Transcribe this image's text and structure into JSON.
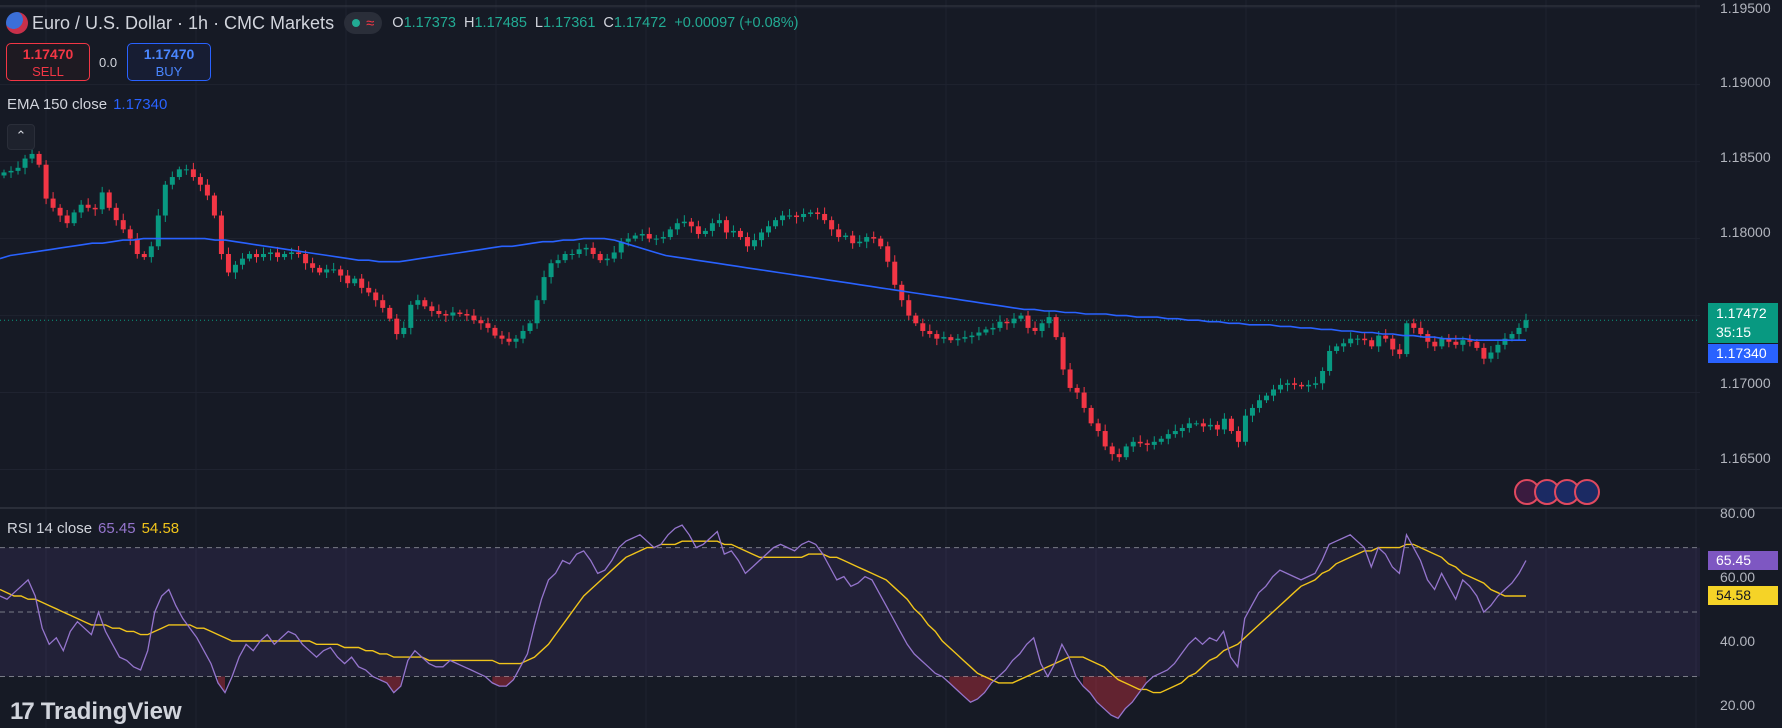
{
  "header": {
    "title": "Euro / U.S. Dollar · 1h · CMC Markets",
    "ohlc": [
      {
        "k": "O",
        "v": "1.17373"
      },
      {
        "k": "H",
        "v": "1.17485"
      },
      {
        "k": "L",
        "v": "1.17361"
      },
      {
        "k": "C",
        "v": "1.17472"
      }
    ],
    "change": "+0.00097 (+0.08%)"
  },
  "trade": {
    "sell_price": "1.17470",
    "sell_label": "SELL",
    "spread": "0.0",
    "buy_price": "1.17470",
    "buy_label": "BUY"
  },
  "ema": {
    "label": "EMA 150 close",
    "value": "1.17340"
  },
  "rsi": {
    "label": "RSI 14 close",
    "value": "65.45",
    "ma_value": "54.58"
  },
  "price_axis": {
    "ticks": [
      "1.19500",
      "1.19000",
      "1.18500",
      "1.18000",
      "1.17000",
      "1.16500"
    ],
    "last_price": "1.17472",
    "countdown": "35:15",
    "ema_tag": "1.17340"
  },
  "rsi_axis": {
    "ticks": [
      "80.00",
      "60.00",
      "40.00",
      "20.00"
    ]
  },
  "branding": {
    "logo_text": "TradingView"
  },
  "colors": {
    "background": "#161a25",
    "up": "#089981",
    "down": "#f23645",
    "ema": "#2962ff",
    "rsi": "#9575cd",
    "rsi_ma": "#f0c41b"
  },
  "chart_data": [
    {
      "type": "candlestick",
      "title": "Euro / U.S. Dollar · 1h · CMC Markets",
      "ylim": [
        1.1625,
        1.1955
      ],
      "series": [
        {
          "name": "EMA 150 close",
          "values": [
            1.1787,
            1.1789,
            1.179,
            1.1791,
            1.1792,
            1.1793,
            1.1794,
            1.1795,
            1.1796,
            1.1797,
            1.1797,
            1.1798,
            1.1799,
            1.1799,
            1.18,
            1.18,
            1.18,
            1.18,
            1.18,
            1.18,
            1.18,
            1.1799,
            1.1799,
            1.1798,
            1.1797,
            1.1796,
            1.1795,
            1.1794,
            1.1793,
            1.1792,
            1.1791,
            1.179,
            1.1789,
            1.1788,
            1.1787,
            1.1786,
            1.1786,
            1.1785,
            1.1785,
            1.1785,
            1.1786,
            1.1787,
            1.1788,
            1.1789,
            1.179,
            1.1791,
            1.1792,
            1.1793,
            1.1794,
            1.1795,
            1.1795,
            1.1796,
            1.1797,
            1.1798,
            1.1798,
            1.1799,
            1.1799,
            1.18,
            1.18,
            1.18,
            1.1799,
            1.1797,
            1.1795,
            1.1793,
            1.1791,
            1.1789,
            1.1788,
            1.1787,
            1.1786,
            1.1785,
            1.1784,
            1.1783,
            1.1782,
            1.1781,
            1.178,
            1.1779,
            1.1778,
            1.1777,
            1.1776,
            1.1775,
            1.1774,
            1.1773,
            1.1772,
            1.1771,
            1.177,
            1.1769,
            1.1768,
            1.1767,
            1.1766,
            1.1765,
            1.1764,
            1.1763,
            1.1762,
            1.1761,
            1.176,
            1.1759,
            1.1758,
            1.1757,
            1.1756,
            1.1755,
            1.1754,
            1.1754,
            1.1753,
            1.1753,
            1.1752,
            1.1752,
            1.1751,
            1.1751,
            1.1751,
            1.175,
            1.175,
            1.1749,
            1.1749,
            1.1749,
            1.1748,
            1.1748,
            1.1747,
            1.1747,
            1.1746,
            1.1746,
            1.1745,
            1.1745,
            1.1744,
            1.1744,
            1.1744,
            1.1743,
            1.1743,
            1.1742,
            1.1742,
            1.1741,
            1.1741,
            1.174,
            1.174,
            1.1739,
            1.1739,
            1.1738,
            1.1738,
            1.1737,
            1.1737,
            1.1736,
            1.1736,
            1.1735,
            1.1735,
            1.1735,
            1.1734,
            1.1734,
            1.1734,
            1.1734,
            1.1734,
            1.1734
          ]
        },
        {
          "name": "close",
          "values": [
            1.1843,
            1.1844,
            1.1846,
            1.1852,
            1.1855,
            1.1848,
            1.1826,
            1.182,
            1.1815,
            1.181,
            1.1817,
            1.1822,
            1.182,
            1.1819,
            1.183,
            1.182,
            1.1812,
            1.1806,
            1.18,
            1.179,
            1.1788,
            1.1795,
            1.1815,
            1.1835,
            1.184,
            1.1845,
            1.1845,
            1.184,
            1.1835,
            1.1828,
            1.1815,
            1.179,
            1.1778,
            1.1783,
            1.1787,
            1.179,
            1.1788,
            1.179,
            1.1791,
            1.1788,
            1.179,
            1.1791,
            1.179,
            1.1784,
            1.1781,
            1.1778,
            1.178,
            1.178,
            1.1776,
            1.1771,
            1.1774,
            1.1768,
            1.1765,
            1.176,
            1.1755,
            1.1748,
            1.1738,
            1.1742,
            1.1757,
            1.176,
            1.1756,
            1.1753,
            1.1751,
            1.175,
            1.1752,
            1.1751,
            1.175,
            1.1747,
            1.1745,
            1.1742,
            1.1737,
            1.1735,
            1.1733,
            1.1735,
            1.174,
            1.1745,
            1.176,
            1.1775,
            1.1784,
            1.1786,
            1.179,
            1.179,
            1.1793,
            1.1794,
            1.179,
            1.1786,
            1.1787,
            1.1791,
            1.1798,
            1.18,
            1.1802,
            1.1803,
            1.18,
            1.18,
            1.1801,
            1.1806,
            1.181,
            1.1811,
            1.1808,
            1.1803,
            1.1805,
            1.181,
            1.1812,
            1.1804,
            1.1805,
            1.1801,
            1.1795,
            1.1799,
            1.1804,
            1.1808,
            1.1812,
            1.1815,
            1.1815,
            1.1814,
            1.1816,
            1.1817,
            1.1816,
            1.1812,
            1.1806,
            1.1801,
            1.1802,
            1.1797,
            1.1798,
            1.1801,
            1.18,
            1.1795,
            1.1785,
            1.177,
            1.176,
            1.175,
            1.1745,
            1.174,
            1.1738,
            1.1735,
            1.1736,
            1.1734,
            1.1735,
            1.1736,
            1.1737,
            1.1739,
            1.1741,
            1.1742,
            1.1746,
            1.1745,
            1.1748,
            1.175,
            1.1742,
            1.174,
            1.1745,
            1.1749,
            1.1736,
            1.1715,
            1.1703,
            1.17,
            1.169,
            1.168,
            1.1675,
            1.1665,
            1.166,
            1.1658,
            1.1665,
            1.1668,
            1.1667,
            1.1666,
            1.1668,
            1.167,
            1.1673,
            1.1675,
            1.1677,
            1.168,
            1.168,
            1.1678,
            1.1679,
            1.1676,
            1.1683,
            1.1675,
            1.1668,
            1.1685,
            1.169,
            1.1695,
            1.1698,
            1.1702,
            1.1705,
            1.1706,
            1.1705,
            1.1704,
            1.1705,
            1.1706,
            1.1714,
            1.1727,
            1.173,
            1.1732,
            1.1735,
            1.1735,
            1.1734,
            1.173,
            1.1737,
            1.1735,
            1.1728,
            1.1725,
            1.1745,
            1.1742,
            1.1738,
            1.1733,
            1.173,
            1.1735,
            1.1733,
            1.1731,
            1.1734,
            1.1733,
            1.1729,
            1.1722,
            1.1726,
            1.1731,
            1.1735,
            1.1738,
            1.1742,
            1.1747
          ]
        }
      ]
    },
    {
      "type": "line",
      "title": "RSI 14 close",
      "ylim": [
        14,
        82
      ],
      "bands": [
        30,
        50,
        70
      ],
      "series": [
        {
          "name": "RSI",
          "values": [
            55,
            54,
            56,
            58,
            60,
            55,
            45,
            40,
            42,
            38,
            44,
            47,
            45,
            43,
            50,
            44,
            40,
            36,
            35,
            33,
            32,
            38,
            50,
            55,
            57,
            52,
            48,
            45,
            42,
            38,
            34,
            28,
            25,
            30,
            36,
            40,
            38,
            41,
            43,
            40,
            42,
            44,
            43,
            40,
            38,
            36,
            38,
            39,
            36,
            34,
            36,
            33,
            32,
            30,
            29,
            28,
            25,
            27,
            35,
            38,
            36,
            34,
            33,
            33,
            35,
            34,
            33,
            32,
            31,
            30,
            28,
            27,
            27,
            29,
            33,
            37,
            46,
            54,
            60,
            62,
            66,
            65,
            68,
            69,
            66,
            62,
            63,
            66,
            70,
            72,
            73,
            74,
            72,
            70,
            71,
            74,
            76,
            77,
            74,
            70,
            71,
            73,
            75,
            68,
            69,
            66,
            62,
            64,
            66,
            68,
            70,
            71,
            70,
            69,
            71,
            72,
            71,
            68,
            64,
            60,
            61,
            58,
            59,
            61,
            60,
            56,
            52,
            48,
            44,
            40,
            37,
            35,
            33,
            31,
            30,
            28,
            26,
            24,
            22,
            23,
            25,
            28,
            30,
            32,
            35,
            37,
            40,
            42,
            34,
            30,
            34,
            40,
            36,
            30,
            27,
            25,
            22,
            20,
            18,
            17,
            20,
            22,
            25,
            28,
            30,
            31,
            32,
            34,
            37,
            40,
            42,
            40,
            42,
            41,
            44,
            36,
            33,
            48,
            52,
            56,
            58,
            61,
            63,
            62,
            61,
            60,
            61,
            62,
            66,
            71,
            72,
            73,
            74,
            72,
            70,
            64,
            70,
            68,
            64,
            62,
            74,
            70,
            66,
            60,
            57,
            62,
            58,
            54,
            60,
            58,
            55,
            50,
            52,
            55,
            57,
            59,
            62,
            66
          ]
        },
        {
          "name": "RSI-based MA",
          "values": [
            57,
            56,
            55,
            55,
            54,
            54,
            53,
            52,
            51,
            50,
            49,
            48,
            47,
            46,
            46,
            46,
            45,
            45,
            44,
            44,
            43,
            43,
            44,
            45,
            46,
            46,
            46,
            46,
            45,
            45,
            44,
            43,
            42,
            41,
            41,
            41,
            41,
            41,
            41,
            41,
            41,
            41,
            41,
            41,
            41,
            40,
            40,
            40,
            40,
            39,
            39,
            39,
            38,
            38,
            37,
            37,
            36,
            36,
            36,
            36,
            36,
            35,
            35,
            35,
            35,
            35,
            35,
            35,
            35,
            35,
            35,
            34,
            34,
            34,
            34,
            35,
            36,
            38,
            40,
            43,
            46,
            49,
            52,
            55,
            57,
            59,
            61,
            63,
            65,
            67,
            68,
            69,
            70,
            70,
            71,
            71,
            71,
            72,
            72,
            72,
            72,
            72,
            72,
            71,
            71,
            70,
            69,
            68,
            67,
            67,
            67,
            67,
            67,
            67,
            67,
            68,
            68,
            68,
            67,
            67,
            66,
            65,
            64,
            63,
            62,
            61,
            60,
            58,
            56,
            54,
            51,
            49,
            46,
            44,
            41,
            39,
            37,
            35,
            33,
            31,
            30,
            29,
            28,
            28,
            28,
            29,
            30,
            31,
            32,
            33,
            34,
            35,
            36,
            36,
            36,
            35,
            34,
            33,
            31,
            29,
            28,
            27,
            26,
            26,
            25,
            25,
            26,
            27,
            28,
            30,
            31,
            33,
            35,
            36,
            38,
            39,
            40,
            42,
            44,
            46,
            48,
            50,
            52,
            54,
            56,
            58,
            59,
            60,
            62,
            63,
            65,
            66,
            67,
            68,
            69,
            69,
            70,
            70,
            70,
            70,
            71,
            71,
            70,
            69,
            68,
            67,
            65,
            64,
            62,
            61,
            60,
            59,
            57,
            56,
            55,
            55,
            55,
            55
          ]
        }
      ]
    }
  ]
}
